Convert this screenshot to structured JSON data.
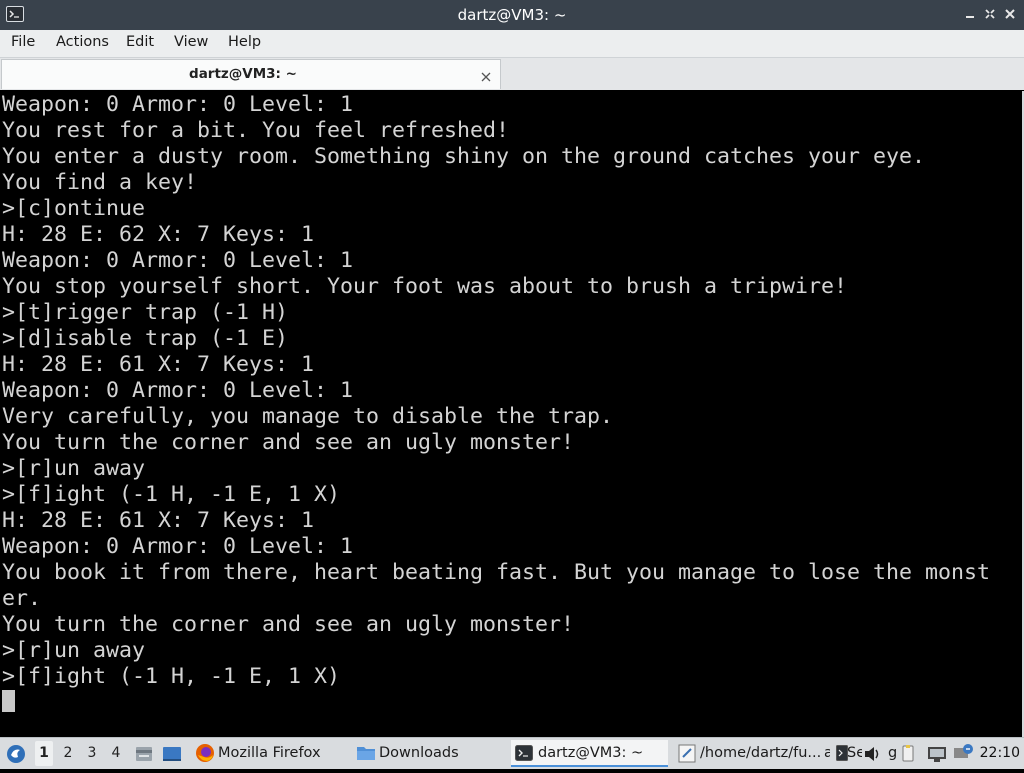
{
  "window": {
    "title": "dartz@VM3: ~"
  },
  "menubar": {
    "items": [
      "File",
      "Actions",
      "Edit",
      "View",
      "Help"
    ]
  },
  "tab": {
    "label": "dartz@VM3: ~"
  },
  "terminal": {
    "lines": [
      "Weapon: 0 Armor: 0 Level: 1",
      "You rest for a bit. You feel refreshed!",
      "You enter a dusty room. Something shiny on the ground catches your eye.",
      "You find a key!",
      ">[c]ontinue",
      "H: 28 E: 62 X: 7 Keys: 1",
      "Weapon: 0 Armor: 0 Level: 1",
      "You stop yourself short. Your foot was about to brush a tripwire!",
      ">[t]rigger trap (-1 H)",
      ">[d]isable trap (-1 E)",
      "H: 28 E: 61 X: 7 Keys: 1",
      "Weapon: 0 Armor: 0 Level: 1",
      "Very carefully, you manage to disable the trap.",
      "You turn the corner and see an ugly monster!",
      ">[r]un away",
      ">[f]ight (-1 H, -1 E, 1 X)",
      "H: 28 E: 61 X: 7 Keys: 1",
      "Weapon: 0 Armor: 0 Level: 1",
      "You book it from there, heart beating fast. But you manage to lose the monst",
      "er.",
      "You turn the corner and see an ugly monster!",
      ">[r]un away",
      ">[f]ight (-1 H, -1 E, 1 X)"
    ]
  },
  "taskbar": {
    "workspaces": [
      "1",
      "2",
      "3",
      "4"
    ],
    "active_workspace": "1",
    "tasks": {
      "firefox": "Mozilla Firefox",
      "downloads": "Downloads",
      "terminal": "dartz@VM3: ~",
      "editor": "/home/dartz/fu...",
      "editor_trail": "a",
      "partial_se": "Se",
      "partial_g": "g"
    },
    "clock": "22:10"
  },
  "colors": {
    "titlebar_bg": "#39424c",
    "terminal_bg": "#000000",
    "terminal_fg": "#d4d4d4",
    "taskbar_bg": "#d9dcdf",
    "accent": "#4a90d9"
  },
  "icons": {
    "app": "terminal-icon",
    "minimize": "minimize-icon",
    "maximize": "maximize-icon",
    "close": "close-icon"
  }
}
